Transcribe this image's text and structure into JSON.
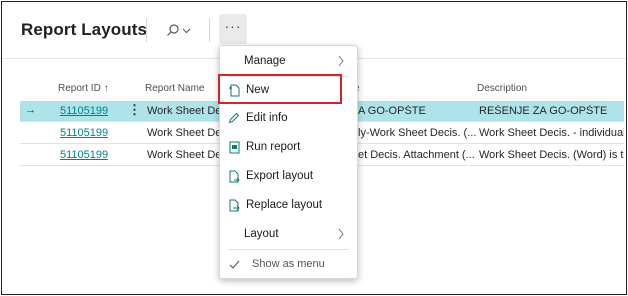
{
  "page": {
    "title": "Report Layouts"
  },
  "toolbar": {
    "search_icon": "search-icon",
    "more_label": "···"
  },
  "table": {
    "columns": [
      {
        "label": "Report ID ↑"
      },
      {
        "label": "Report Name"
      },
      {
        "label": "e"
      },
      {
        "label": "Description"
      }
    ],
    "rows": [
      {
        "report_id": "51105199",
        "report_name": "Work Sheet Dec",
        "layout_name": "A GO-OPŠTE",
        "description": "REŠENJE ZA GO-OPŠTE"
      },
      {
        "report_id": "51105199",
        "report_name": "Work Sheet Dec",
        "layout_name": "ly-Work Sheet Decis. (...",
        "description": "Work Sheet Decis. - individual"
      },
      {
        "report_id": "51105199",
        "report_name": "Work Sheet Dec",
        "layout_name": "et Decis. Attachment (...",
        "description": "Work Sheet Decis. (Word) is the"
      }
    ],
    "selected_row_marker": "→"
  },
  "menu": {
    "manage": "Manage",
    "new": "New",
    "edit_info": "Edit info",
    "run_report": "Run report",
    "export_layout": "Export layout",
    "replace_layout": "Replace layout",
    "layout": "Layout",
    "show_as_menu": "Show as menu"
  },
  "colors": {
    "selected_row": "#aee3ea",
    "link": "#00818e",
    "highlight_box": "#d1242f"
  }
}
